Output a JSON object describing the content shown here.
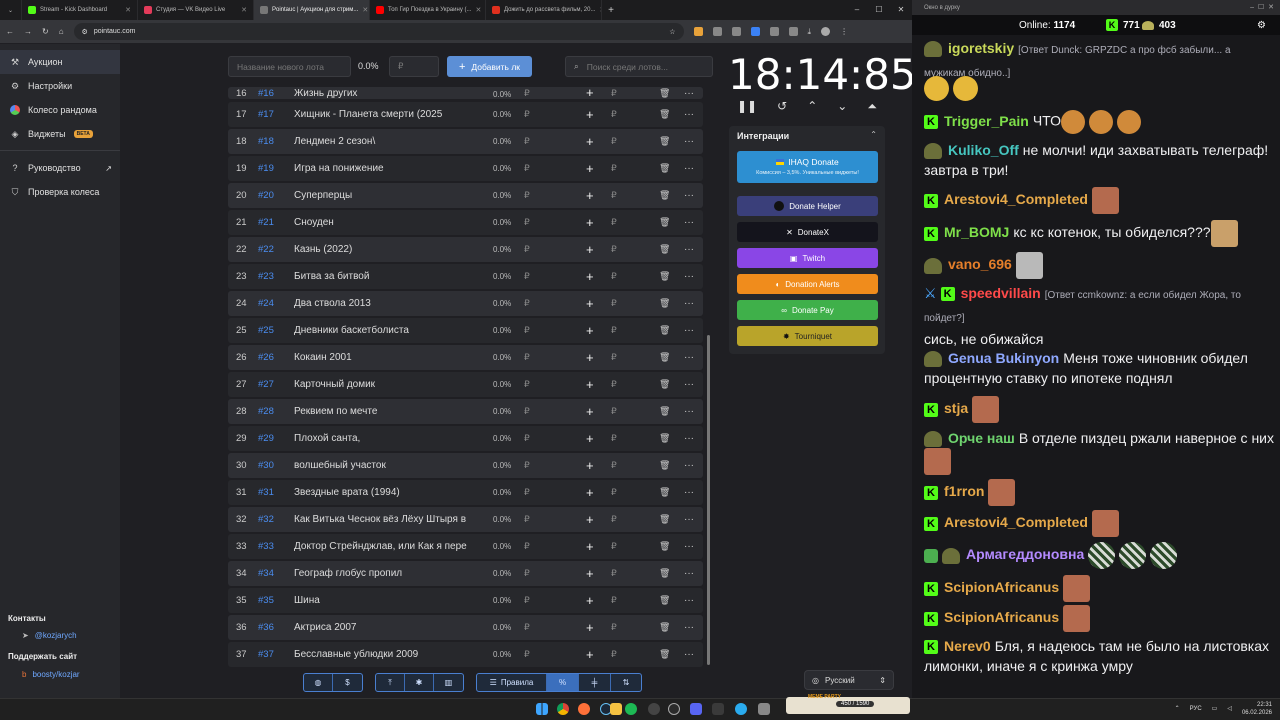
{
  "browser": {
    "tabs": [
      {
        "label": "Stream - Kick Dashboard",
        "color": "#53fc18"
      },
      {
        "label": "Студия — VK Видео Live",
        "color": "#e33b5a"
      },
      {
        "label": "Pointauc | Аукцион для стрим...",
        "color": "#777777"
      },
      {
        "label": "Топ Гир Поездка в Украину (...",
        "color": "#ff0000"
      },
      {
        "label": "Дожить до рассвета фильм, 20...",
        "color": "#e0301e"
      }
    ],
    "new_tab": "+",
    "url": "pointauc.com",
    "window_controls": [
      "–",
      "☐",
      "✕"
    ]
  },
  "sidebar": {
    "items": [
      {
        "label": "Аукцион",
        "icon": "hammer-icon"
      },
      {
        "label": "Настройки",
        "icon": "gear-icon"
      },
      {
        "label": "Колесо рандома",
        "icon": "wheel-icon"
      },
      {
        "label": "Виджеты",
        "icon": "layers-icon",
        "badge": "BETA"
      },
      {
        "label": "Руководство",
        "icon": "help-icon"
      },
      {
        "label": "Проверка колеса",
        "icon": "shield-icon"
      }
    ],
    "contacts_heading": "Контакты",
    "contact_link": "@kozjarych",
    "support_heading": "Поддержать сайт",
    "support_link": "boosty/kozjar"
  },
  "controls": {
    "new_lot_placeholder": "Название нового лота",
    "percent": "0.0%",
    "amount_placeholder": "₽",
    "add_button": "Добавить лк",
    "search_placeholder": "Поиск среди лотов..."
  },
  "lots": [
    {
      "n": "16",
      "id": "#16",
      "title": "Жизнь других"
    },
    {
      "n": "17",
      "id": "#17",
      "title": "Хищник - Планета смерти (2025"
    },
    {
      "n": "18",
      "id": "#18",
      "title": "Лендмен 2 сезон\\"
    },
    {
      "n": "19",
      "id": "#19",
      "title": "Игра на понижение"
    },
    {
      "n": "20",
      "id": "#20",
      "title": "Суперперцы"
    },
    {
      "n": "21",
      "id": "#21",
      "title": "Сноуден"
    },
    {
      "n": "22",
      "id": "#22",
      "title": "Казнь (2022)"
    },
    {
      "n": "23",
      "id": "#23",
      "title": "Битва за битвой"
    },
    {
      "n": "24",
      "id": "#24",
      "title": "Два ствола 2013"
    },
    {
      "n": "25",
      "id": "#25",
      "title": "Дневники баскетболиста"
    },
    {
      "n": "26",
      "id": "#26",
      "title": "Кокаин 2001"
    },
    {
      "n": "27",
      "id": "#27",
      "title": "Карточный домик"
    },
    {
      "n": "28",
      "id": "#28",
      "title": "Реквием по мечте"
    },
    {
      "n": "29",
      "id": "#29",
      "title": "Плохой санта,"
    },
    {
      "n": "30",
      "id": "#30",
      "title": "волшебный участок"
    },
    {
      "n": "31",
      "id": "#31",
      "title": "Звездные врата (1994)"
    },
    {
      "n": "32",
      "id": "#32",
      "title": "Как Витька Чеснок вёз Лёху Штыря в"
    },
    {
      "n": "33",
      "id": "#33",
      "title": "Доктор Стрейнджлав, или Как я пере"
    },
    {
      "n": "34",
      "id": "#34",
      "title": "Географ глобус пропил"
    },
    {
      "n": "35",
      "id": "#35",
      "title": "Шина"
    },
    {
      "n": "36",
      "id": "#36",
      "title": "Актриса 2007"
    },
    {
      "n": "37",
      "id": "#37",
      "title": "Бесславные ублюдки 2009"
    }
  ],
  "lot_percent": "0.0%",
  "currency": "₽",
  "timer": {
    "display": "18:14:85"
  },
  "integrations": {
    "title": "Интеграции",
    "ihaq_label": "IHAQ Donate",
    "ihaq_sub": "Комиссия – 3,5%. Уникальные виджеты!",
    "buttons": [
      {
        "label": "Donate Helper",
        "color": "#3a3f7a"
      },
      {
        "label": "DonateX",
        "color": "#14141c"
      },
      {
        "label": "Twitch",
        "color": "#8a46e6"
      },
      {
        "label": "Donation Alerts",
        "color": "#f08c1c"
      },
      {
        "label": "Donate Pay",
        "color": "#3fb04a"
      },
      {
        "label": "Tourniquet",
        "color": "#b9a42a"
      }
    ]
  },
  "bottom_toolbar": {
    "rules": "Правила",
    "percent_symbol": "%"
  },
  "language": "Русский",
  "chat": {
    "window_title": "Окно в дурку",
    "online_label": "Online:",
    "online_count": "1174",
    "kick_count": "771",
    "other_count": "403",
    "messages": [
      {
        "user": "igoretskiy",
        "color": "#c9d95a",
        "reply": "[Ответ Dunck: GRPZDC а про фсб забыли... а мужикам обидно..]",
        "text": ""
      },
      {
        "user": "Trigger_Pain",
        "color": "#7fe04a",
        "text": "ЧТО"
      },
      {
        "user": "Kuliko_Off",
        "color": "#46c6c0",
        "text": "не молчи! иди захватывать телеграф! завтра в три!"
      },
      {
        "user": "Arestovi4_Completed",
        "color": "#e6a94a",
        "text": ""
      },
      {
        "user": "Mr_BOMJ",
        "color": "#7fe04a",
        "text": "кс кс котенок, ты обиделся???"
      },
      {
        "user": "vano_696",
        "color": "#e67f2a",
        "text": ""
      },
      {
        "user": "speedvillain",
        "color": "#ff4a4a",
        "reply": "[Ответ ccmkownz: а если обидел Жора, то пойдет?]",
        "text": "сись, не обижайся"
      },
      {
        "user": "Genua Bukinyon",
        "color": "#8fa8ff",
        "text": "Меня тоже чиновник обидел процентную ставку по ипотеке поднял"
      },
      {
        "user": "stja",
        "color": "#e6a94a",
        "text": ""
      },
      {
        "user": "Орче наш",
        "color": "#6fd46f",
        "text": "В отделе пиздец ржали наверное с них"
      },
      {
        "user": "f1rron",
        "color": "#e6a94a",
        "text": ""
      },
      {
        "user": "Arestovi4_Completed",
        "color": "#e6a94a",
        "text": ""
      },
      {
        "user": "Армагеддоновна",
        "color": "#b48aff",
        "text": ""
      },
      {
        "user": "ScipionAfricanus",
        "color": "#e6a94a",
        "text": ""
      },
      {
        "user": "ScipionAfricanus",
        "color": "#e6a94a",
        "text": ""
      },
      {
        "user": "Nerev0",
        "color": "#e6a94a",
        "text": "Бля, я надеюсь там не было на листовках лимонки, иначе я с кринжа умру"
      }
    ]
  },
  "taskbar": {
    "lang": "РУС",
    "time": "22:31",
    "date": "06.02.2026",
    "meme_label": "MEME PARTY",
    "meme_counter": "450 / 1590"
  }
}
